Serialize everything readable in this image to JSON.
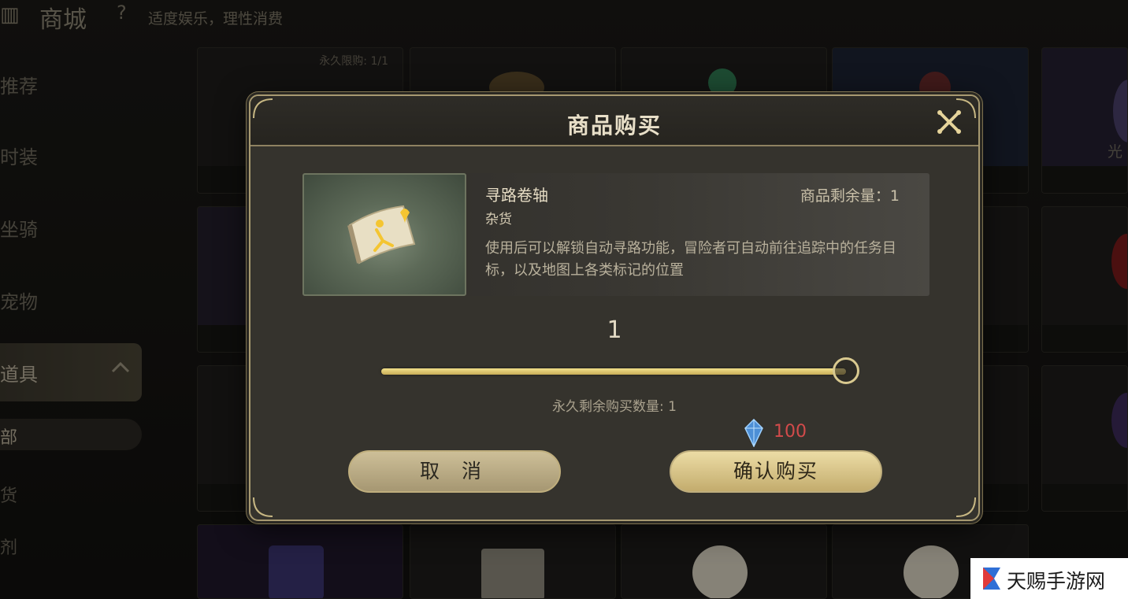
{
  "header": {
    "title": "商城",
    "help_glyph": "?",
    "notice": "适度娱乐，理性消费"
  },
  "sidebar": {
    "items": [
      {
        "label": "推荐"
      },
      {
        "label": "时装"
      },
      {
        "label": "坐骑"
      },
      {
        "label": "宠物"
      },
      {
        "label": "道具"
      }
    ],
    "subitems": [
      {
        "label": "部"
      },
      {
        "label": "货"
      },
      {
        "label": "剂"
      }
    ]
  },
  "shop_cards": {
    "first_card_limit": "永久限购: 1/1",
    "right_card_names": [
      "光"
    ]
  },
  "modal": {
    "title": "商品购买",
    "item": {
      "name": "寻路卷轴",
      "category": "杂货",
      "stock": "商品剩余量：1",
      "description": "使用后可以解锁自动寻路功能，冒险者可自动前往追踪中的任务目标，以及地图上各类标记的位置"
    },
    "quantity": "1",
    "slider_fraction": 1.0,
    "remaining_label": "永久剩余购买数量: 1",
    "price": "100",
    "cancel_label": "取 消",
    "confirm_label": "确认购买"
  },
  "watermark": {
    "text": "天赐手游网"
  },
  "colors": {
    "gold": "#e6d49a",
    "price_red": "#d24b4b",
    "gem_blue": "#4d8fd6"
  }
}
